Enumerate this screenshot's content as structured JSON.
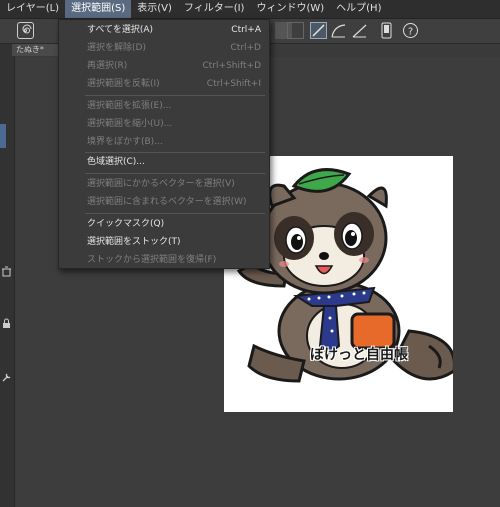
{
  "menubar": {
    "items": [
      {
        "label": "レイヤー(L)"
      },
      {
        "label": "選択範囲(S)"
      },
      {
        "label": "表示(V)"
      },
      {
        "label": "フィルター(I)"
      },
      {
        "label": "ウィンドウ(W)"
      },
      {
        "label": "ヘルプ(H)"
      }
    ]
  },
  "document": {
    "tab_label": "たぬき*"
  },
  "selection_menu": {
    "items": [
      {
        "label": "すべてを選択(A)",
        "shortcut": "Ctrl+A",
        "enabled": true
      },
      {
        "label": "選択を解除(D)",
        "shortcut": "Ctrl+D",
        "enabled": false
      },
      {
        "label": "再選択(R)",
        "shortcut": "Ctrl+Shift+D",
        "enabled": false
      },
      {
        "label": "選択範囲を反転(I)",
        "shortcut": "Ctrl+Shift+I",
        "enabled": false
      },
      {
        "label": "選択範囲を拡張(E)...",
        "shortcut": "",
        "enabled": false
      },
      {
        "label": "選択範囲を縮小(U)...",
        "shortcut": "",
        "enabled": false
      },
      {
        "label": "境界をぼかす(B)...",
        "shortcut": "",
        "enabled": false
      },
      {
        "label": "色域選択(C)...",
        "shortcut": "",
        "enabled": true
      },
      {
        "label": "選択範囲にかかるベクターを選択(V)",
        "shortcut": "",
        "enabled": false
      },
      {
        "label": "選択範囲に含まれるベクターを選択(W)",
        "shortcut": "",
        "enabled": false
      },
      {
        "label": "クイックマスク(Q)",
        "shortcut": "",
        "enabled": true
      },
      {
        "label": "選択範囲をストック(T)",
        "shortcut": "",
        "enabled": true
      },
      {
        "label": "ストックから選択範囲を復帰(F)",
        "shortcut": "",
        "enabled": false
      }
    ]
  },
  "artwork": {
    "caption": "ぽけっと自由帳"
  },
  "colors": {
    "menubar_bg": "#2e2e2e",
    "active_menu": "#5a6a80",
    "dropdown_bg": "#3b3b3b",
    "disabled_text": "#7f7f7f",
    "enabled_text": "#e6e6e6",
    "leaf_green": "#3fa84a",
    "necktie_navy": "#2b3a8c",
    "orange": "#e86a2a"
  },
  "icons": [
    "spiral-icon",
    "pen-tool-icon",
    "curve-tool-icon",
    "ruler-tool-icon",
    "phone-icon",
    "help-icon",
    "trash-icon",
    "lock-icon",
    "wrench-icon"
  ]
}
